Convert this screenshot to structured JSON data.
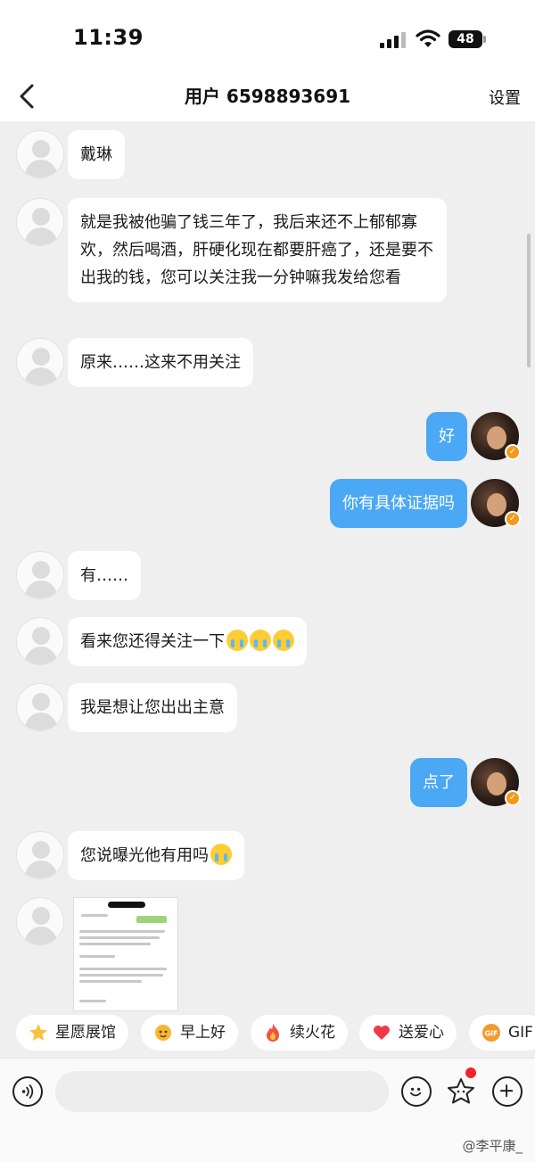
{
  "status": {
    "time": "11:39",
    "battery": "48"
  },
  "nav": {
    "title": "用户 6598893691",
    "settings": "设置"
  },
  "messages": {
    "m1": "戴琳",
    "m2": "就是我被他骗了钱三年了，我后来还不上郁郁寡欢，然后喝酒，肝硬化现在都要肝癌了，还是要不出我的钱，您可以关注我一分钟嘛我发给您看",
    "m3": "原来……这来不用关注",
    "m4": "好",
    "m5": "你有具体证据吗",
    "m6": "有……",
    "m7": "看来您还得关注一下",
    "m8": "我是想让您出出主意",
    "m9": "点了",
    "m10": "您说曝光他有用吗"
  },
  "quick_actions": [
    {
      "label": "星愿展馆",
      "icon": "star-face-icon"
    },
    {
      "label": "早上好",
      "icon": "sun-face-icon"
    },
    {
      "label": "续火花",
      "icon": "fire-icon"
    },
    {
      "label": "送爱心",
      "icon": "heart-icon"
    },
    {
      "label": "GIF",
      "icon": "gif-icon"
    }
  ],
  "input": {
    "placeholder": ""
  },
  "watermark": "@李平康_",
  "colors": {
    "my_bubble": "#4aa8f4",
    "chat_bg": "#efefef",
    "verified": "#f39a1a",
    "notification_dot": "#f5222d"
  }
}
